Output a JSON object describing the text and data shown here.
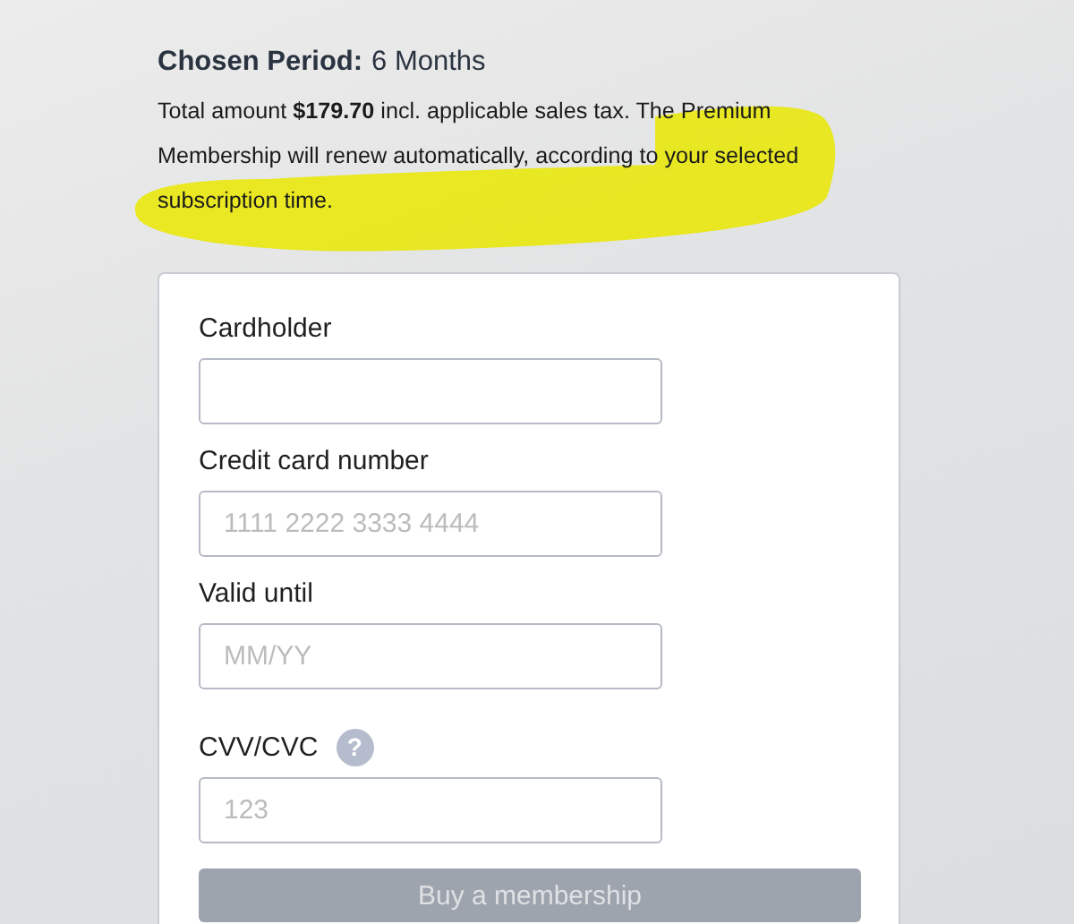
{
  "summary": {
    "label": "Chosen Period:",
    "period": "6 Months",
    "note": "Total amount **$179.70** incl. applicable sales tax. The Premium Membership will renew automatically, according to your selected subscription time.",
    "highlighted": true
  },
  "form": {
    "fields": [
      {
        "label": "Cardholder"
      },
      {
        "label": "Credit card number",
        "placeholder": "1111 2222 3333 4444"
      },
      {
        "label": "Valid until",
        "placeholder": "MM/YY"
      },
      {
        "label": "CVV/CVC",
        "placeholder": "123",
        "help": "?"
      }
    ],
    "submit": {
      "label": "Buy a membership",
      "disabled": true
    }
  }
}
